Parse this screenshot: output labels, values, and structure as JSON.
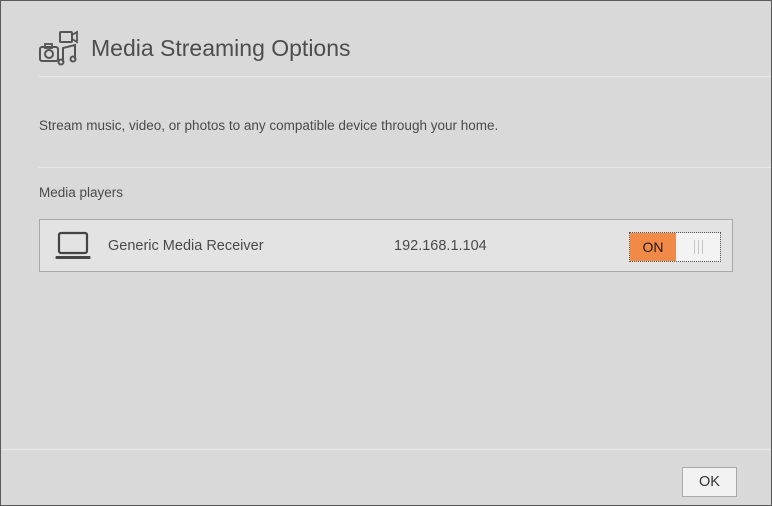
{
  "dialog": {
    "title": "Media Streaming Options",
    "title_icon": "media-streaming-icon",
    "description": "Stream music, video, or photos to any compatible device through your home."
  },
  "media_players": {
    "label": "Media players",
    "items": [
      {
        "icon": "laptop-icon",
        "name": "Generic Media Receiver",
        "ip": "192.168.1.104",
        "toggle_label": "ON",
        "enabled": true
      }
    ]
  },
  "footer": {
    "ok_label": "OK"
  },
  "colors": {
    "background": "#d9d9d9",
    "toggle_on": "#f28a47",
    "text": "#4a4a4a"
  }
}
